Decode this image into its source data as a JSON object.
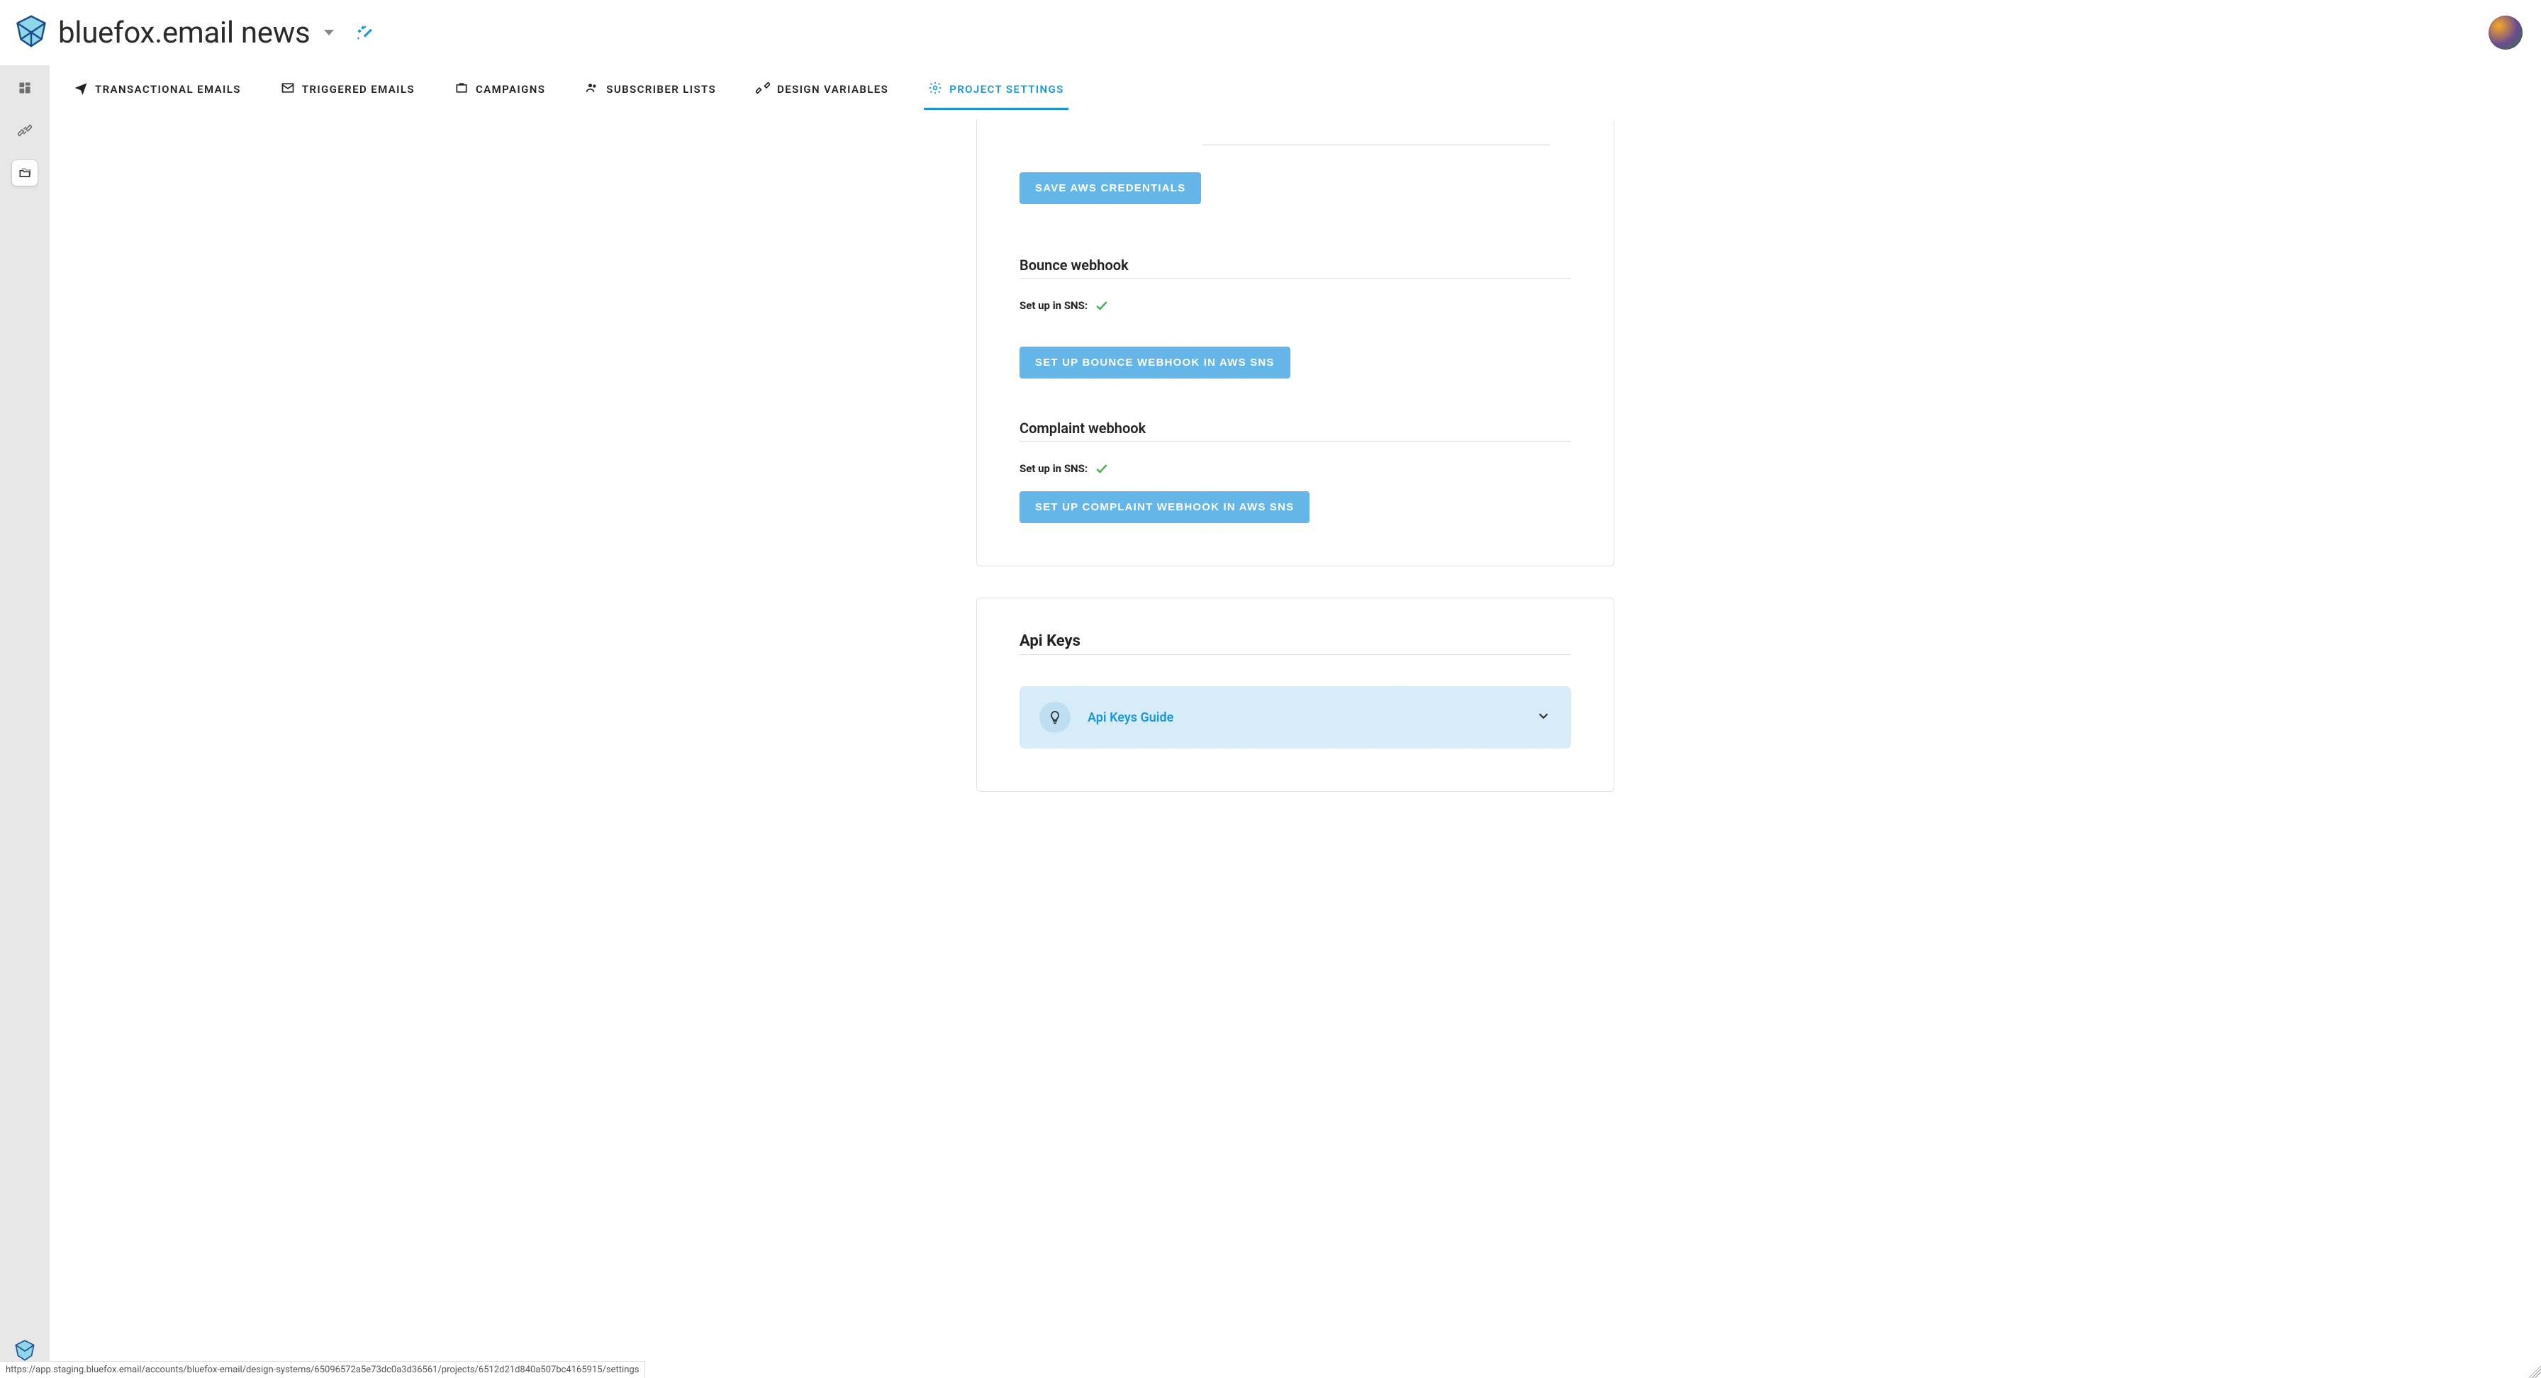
{
  "header": {
    "project_title": "bluefox.email news"
  },
  "tabs": {
    "transactional": "Transactional Emails",
    "triggered": "Triggered Emails",
    "campaigns": "Campaigns",
    "subscriber_lists": "Subscriber Lists",
    "design_variables": "Design Variables",
    "project_settings": "Project Settings"
  },
  "aws": {
    "save_button": "Save AWS credentials",
    "bounce_heading": "Bounce webhook",
    "bounce_status_label": "Set up in SNS:",
    "bounce_button": "Set up bounce webhook in AWS SNS",
    "complaint_heading": "Complaint webhook",
    "complaint_status_label": "Set up in SNS:",
    "complaint_button": "Set up complaint webhook in AWS SNS"
  },
  "api_keys": {
    "heading": "Api Keys",
    "guide_title": "Api Keys Guide"
  },
  "status_url": "https://app.staging.bluefox.email/accounts/bluefox-email/design-systems/65096572a5e73dc0a3d36561/projects/6512d21d840a507bc4165915/settings"
}
